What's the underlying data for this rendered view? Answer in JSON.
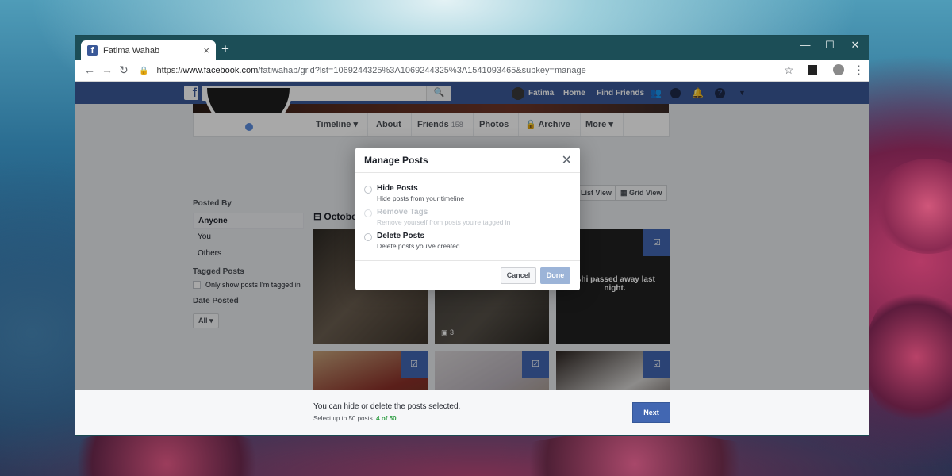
{
  "browser": {
    "tab_title": "Fatima Wahab",
    "tab_close": "×",
    "new_tab": "+",
    "controls": [
      "—",
      "☐",
      "✕"
    ],
    "url_scheme": "https://",
    "url_host": "www.facebook.com",
    "url_rest": "/fatiwahab/grid?lst=1069244325%3A1069244325%3A1541093465&subkey=manage"
  },
  "fb_header": {
    "search_placeholder": "Search",
    "user_name": "Fatima",
    "home": "Home",
    "find_friends": "Find Friends"
  },
  "profile_tabs": [
    {
      "label": "Timeline ▾"
    },
    {
      "label": "About"
    },
    {
      "label": "Friends",
      "count": "158"
    },
    {
      "label": "Photos"
    },
    {
      "label": "Archive"
    },
    {
      "label": "More ▾"
    }
  ],
  "view_toggle": {
    "list": "List View",
    "grid": "Grid View"
  },
  "filters": {
    "posted_by_heading": "Posted By",
    "posted_by": [
      "Anyone",
      "You",
      "Others"
    ],
    "tagged_heading": "Tagged Posts",
    "tagged_checkbox": "Only show posts I'm tagged in",
    "date_heading": "Date Posted",
    "date_value": "All ▾"
  },
  "month_heading": "October",
  "photos": {
    "text_post": "ishi passed away last night.",
    "photo_count": "3"
  },
  "bottom_bar": {
    "message": "You can hide or delete the posts selected.",
    "limit_text": "Select up to 50 posts.",
    "selected_count": "4 of 50",
    "next": "Next"
  },
  "dialog": {
    "title": "Manage Posts",
    "options": [
      {
        "title": "Hide Posts",
        "desc": "Hide posts from your timeline",
        "enabled": true
      },
      {
        "title": "Remove Tags",
        "desc": "Remove yourself from posts you're tagged in",
        "enabled": false
      },
      {
        "title": "Delete Posts",
        "desc": "Delete posts you've created",
        "enabled": true
      }
    ],
    "cancel": "Cancel",
    "done": "Done"
  },
  "colors": {
    "facebook_blue": "#3b5998",
    "browser_frame": "#1c4e57",
    "checkbox_blue": "#4267b2"
  }
}
